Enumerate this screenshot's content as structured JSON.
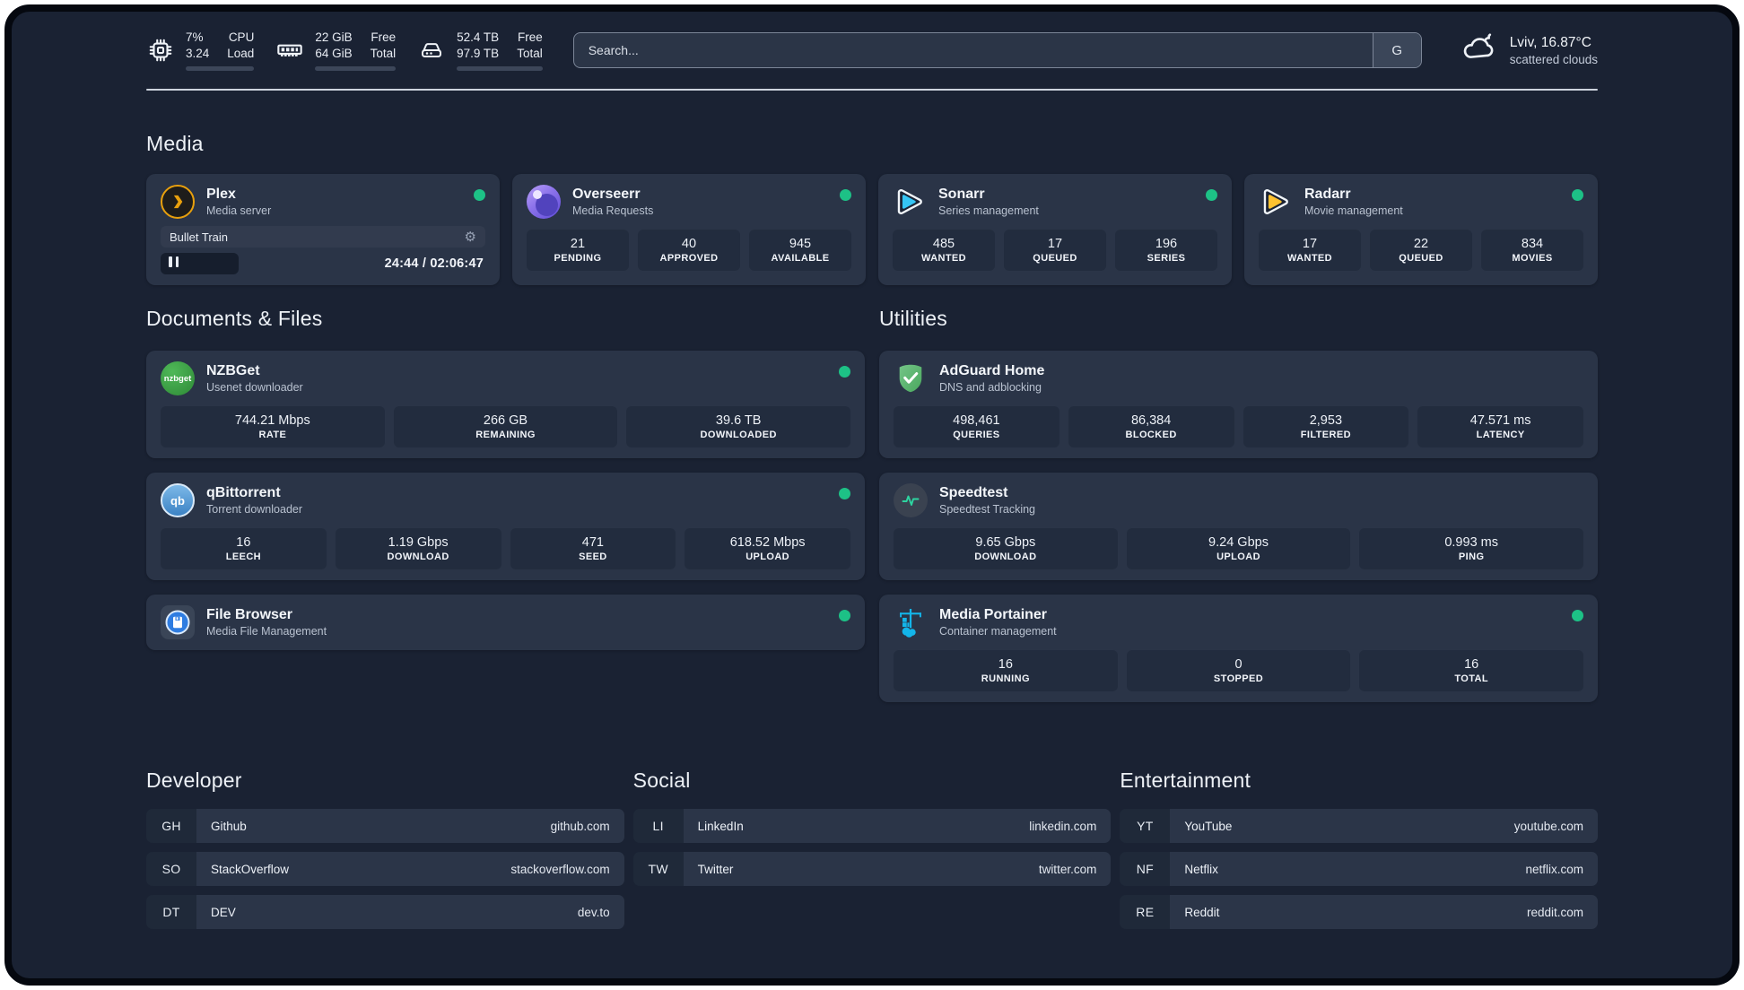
{
  "header": {
    "cpu": {
      "value_top": "7%",
      "value_bottom": "3.24",
      "label_top": "CPU",
      "label_bottom": "Load",
      "progress_pct": 7
    },
    "memory": {
      "value_top": "22 GiB",
      "value_bottom": "64 GiB",
      "label_top": "Free",
      "label_bottom": "Total",
      "progress_pct": 66
    },
    "storage": {
      "value_top": "52.4 TB",
      "value_bottom": "97.9 TB",
      "label_top": "Free",
      "label_bottom": "Total",
      "progress_pct": 47
    },
    "search": {
      "placeholder": "Search...",
      "engine_button": "G"
    },
    "weather": {
      "location_temp": "Lviv, 16.87°C",
      "condition": "scattered clouds"
    }
  },
  "media": {
    "title": "Media",
    "plex": {
      "name": "Plex",
      "desc": "Media server",
      "status": "online",
      "now_playing": {
        "title": "Bullet Train",
        "time": "24:44 / 02:06:47",
        "progress_pct": 24
      }
    },
    "overseerr": {
      "name": "Overseerr",
      "desc": "Media Requests",
      "status": "online",
      "stats": [
        {
          "value": "21",
          "label": "PENDING"
        },
        {
          "value": "40",
          "label": "APPROVED"
        },
        {
          "value": "945",
          "label": "AVAILABLE"
        }
      ]
    },
    "sonarr": {
      "name": "Sonarr",
      "desc": "Series management",
      "status": "online",
      "stats": [
        {
          "value": "485",
          "label": "WANTED"
        },
        {
          "value": "17",
          "label": "QUEUED"
        },
        {
          "value": "196",
          "label": "SERIES"
        }
      ]
    },
    "radarr": {
      "name": "Radarr",
      "desc": "Movie management",
      "status": "online",
      "stats": [
        {
          "value": "17",
          "label": "WANTED"
        },
        {
          "value": "22",
          "label": "QUEUED"
        },
        {
          "value": "834",
          "label": "MOVIES"
        }
      ]
    }
  },
  "documents": {
    "title": "Documents & Files",
    "nzbget": {
      "name": "NZBGet",
      "desc": "Usenet downloader",
      "status": "online",
      "logo_text": "nzbget",
      "stats": [
        {
          "value": "744.21 Mbps",
          "label": "RATE"
        },
        {
          "value": "266 GB",
          "label": "REMAINING"
        },
        {
          "value": "39.6 TB",
          "label": "DOWNLOADED"
        }
      ]
    },
    "qbittorrent": {
      "name": "qBittorrent",
      "desc": "Torrent downloader",
      "status": "online",
      "logo_text": "qb",
      "stats": [
        {
          "value": "16",
          "label": "LEECH"
        },
        {
          "value": "1.19 Gbps",
          "label": "DOWNLOAD"
        },
        {
          "value": "471",
          "label": "SEED"
        },
        {
          "value": "618.52 Mbps",
          "label": "UPLOAD"
        }
      ]
    },
    "filebrowser": {
      "name": "File Browser",
      "desc": "Media File Management",
      "status": "online"
    }
  },
  "utilities": {
    "title": "Utilities",
    "adguard": {
      "name": "AdGuard Home",
      "desc": "DNS and adblocking",
      "stats": [
        {
          "value": "498,461",
          "label": "QUERIES"
        },
        {
          "value": "86,384",
          "label": "BLOCKED"
        },
        {
          "value": "2,953",
          "label": "FILTERED"
        },
        {
          "value": "47.571 ms",
          "label": "LATENCY"
        }
      ]
    },
    "speedtest": {
      "name": "Speedtest",
      "desc": "Speedtest Tracking",
      "stats": [
        {
          "value": "9.65 Gbps",
          "label": "DOWNLOAD"
        },
        {
          "value": "9.24 Gbps",
          "label": "UPLOAD"
        },
        {
          "value": "0.993 ms",
          "label": "PING"
        }
      ]
    },
    "portainer": {
      "name": "Media Portainer",
      "desc": "Container management",
      "status": "online",
      "stats": [
        {
          "value": "16",
          "label": "RUNNING"
        },
        {
          "value": "0",
          "label": "STOPPED"
        },
        {
          "value": "16",
          "label": "TOTAL"
        }
      ]
    }
  },
  "bookmarks": [
    {
      "title": "Developer",
      "items": [
        {
          "abbr": "GH",
          "name": "Github",
          "url": "github.com"
        },
        {
          "abbr": "SO",
          "name": "StackOverflow",
          "url": "stackoverflow.com"
        },
        {
          "abbr": "DT",
          "name": "DEV",
          "url": "dev.to"
        }
      ]
    },
    {
      "title": "Social",
      "items": [
        {
          "abbr": "LI",
          "name": "LinkedIn",
          "url": "linkedin.com"
        },
        {
          "abbr": "TW",
          "name": "Twitter",
          "url": "twitter.com"
        }
      ]
    },
    {
      "title": "Entertainment",
      "items": [
        {
          "abbr": "YT",
          "name": "YouTube",
          "url": "youtube.com"
        },
        {
          "abbr": "NF",
          "name": "Netflix",
          "url": "netflix.com"
        },
        {
          "abbr": "RE",
          "name": "Reddit",
          "url": "reddit.com"
        }
      ]
    }
  ],
  "colors": {
    "background": "#1a2233",
    "card": "#2a3447",
    "tile": "#222c3e",
    "status_online": "#1dc186",
    "plex_accent": "#e8a00d",
    "sonarr_accent": "#35c5f4",
    "radarr_accent": "#ffc230",
    "portainer_accent": "#13b5ea"
  }
}
